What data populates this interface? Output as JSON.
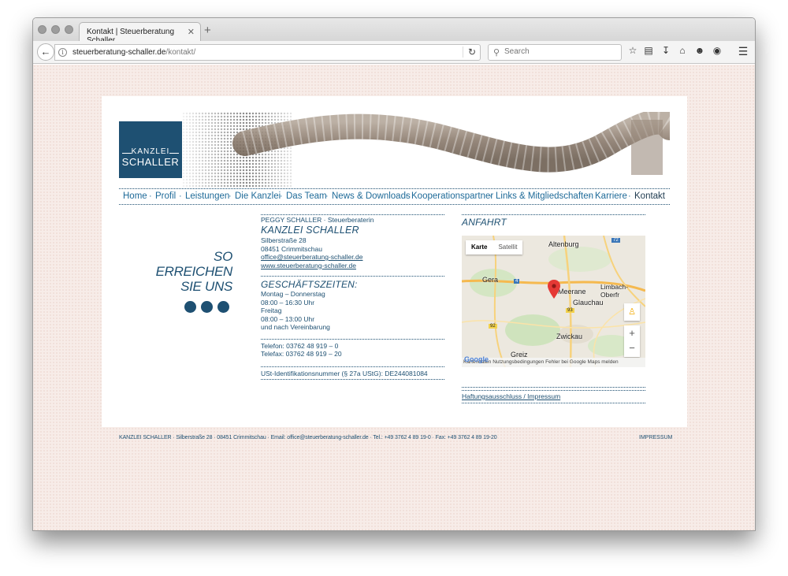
{
  "browser": {
    "tab_title": "Kontakt | Steuerberatung Schaller",
    "tab_close": "✕",
    "new_tab": "+",
    "url_domain": "steuerberatung-schaller.de",
    "url_path": "/kontakt/",
    "search_placeholder": "Search"
  },
  "logo": {
    "line1": "KANZLEI",
    "line2": "SCHALLER"
  },
  "menu": [
    {
      "label": "Home"
    },
    {
      "label": "Profil"
    },
    {
      "label": "Leistungen"
    },
    {
      "label": "Die Kanzlei"
    },
    {
      "label": "Das Team"
    },
    {
      "label": "News & Downloads"
    },
    {
      "label": "Kooperationspartner"
    },
    {
      "label": "Links & Mitgliedschaften"
    },
    {
      "label": "Karriere"
    },
    {
      "label": "Kontakt"
    }
  ],
  "slogan": {
    "line1": "SO",
    "line2": "ERREICHEN",
    "line3": "SIE UNS"
  },
  "contact": {
    "person": "PEGGY SCHALLER  ·  Steuerberaterin",
    "firm": "KANZLEI SCHALLER",
    "street": "Silberstraße 28",
    "city": "08451 Crimmitschau",
    "email": "office@steuerberatung-schaller.de",
    "web": "www.steuerberatung-schaller.de",
    "hours_title": "GESCHÄFTSZEITEN:",
    "hours_line1": "Montag – Donnerstag",
    "hours_line2": "08:00 – 16:30 Uhr",
    "hours_line3": "Freitag",
    "hours_line4": "08:00 – 13:00 Uhr",
    "hours_line5": "und nach Vereinbarung",
    "phone": "Telefon: 03762 48 919 – 0",
    "fax": "Telefax: 03762 48 919 – 20",
    "vat": "USt-Identifikationsnummer (§ 27a UStG): DE244081084"
  },
  "directions": {
    "title": "ANFAHRT",
    "map_tab_map": "Karte",
    "map_tab_sat": "Satellit",
    "cities": [
      "Altenburg",
      "Gera",
      "Meerane",
      "Limbach-Oberfr",
      "Glauchau",
      "Zwickau",
      "Greiz"
    ],
    "road_labels": [
      "72",
      "4",
      "93",
      "92"
    ],
    "map_footer": "Kartendaten    Nutzungsbedingungen    Fehler bei Google Maps melden",
    "google": "Google",
    "zoom_in": "+",
    "zoom_out": "−",
    "legal_link": "Haftungsausschluss / Impressum"
  },
  "footer": {
    "text": "KANZLEI SCHALLER · Silberstraße 28 · 08451 Crimmitschau · Email: office@steuerberatung-schaller.de · Tel.: +49 3762 4 89 19-0 · Fax: +49 3762 4 89 19-20",
    "impressum": "IMPRESSUM"
  },
  "colors": {
    "brand": "#1e5072",
    "link": "#1e6a98",
    "page_bg": "#f7ece8"
  }
}
